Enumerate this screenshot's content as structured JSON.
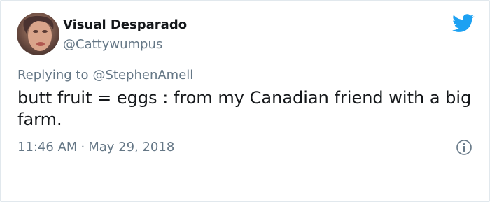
{
  "tweet": {
    "author": {
      "display_name": "Visual Desparado",
      "handle": "@Cattywumpus"
    },
    "reply": {
      "prefix": "Replying to",
      "handle": "@StephenAmell"
    },
    "text": "butt fruit = eggs : from my Canadian friend with a big farm.",
    "time": "11:46 AM",
    "separator": "·",
    "date": "May 29, 2018"
  },
  "icons": {
    "brand": "twitter-bird-icon",
    "info": "info-icon"
  },
  "colors": {
    "brand_blue": "#1da1f2",
    "secondary_text": "#657786",
    "primary_text": "#14171a",
    "divider": "#ccd6dd"
  }
}
